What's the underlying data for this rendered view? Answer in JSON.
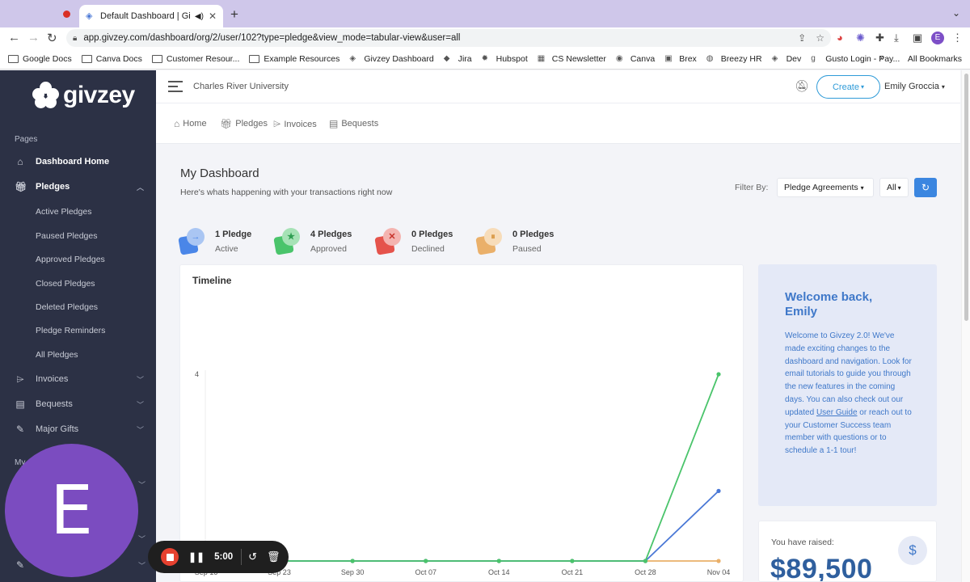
{
  "browser": {
    "tab_title": "Default Dashboard | Givzey",
    "url": "app.givzey.com/dashboard/org/2/user/102?type=pledge&view_mode=tabular-view&user=all",
    "profile_initial": "E",
    "bookmarks": [
      {
        "label": "Google Docs",
        "icon": "folder-icon"
      },
      {
        "label": "Canva Docs",
        "icon": "folder-icon"
      },
      {
        "label": "Customer Resour...",
        "icon": "folder-icon"
      },
      {
        "label": "Example Resources",
        "icon": "folder-icon"
      },
      {
        "label": "Givzey Dashboard",
        "icon": "givzey-icon"
      },
      {
        "label": "Jira",
        "icon": "jira-icon"
      },
      {
        "label": "Hubspot",
        "icon": "hubspot-icon"
      },
      {
        "label": "CS Newsletter",
        "icon": "newsletter-icon"
      },
      {
        "label": "Canva",
        "icon": "canva-icon"
      },
      {
        "label": "Brex",
        "icon": "brex-icon"
      },
      {
        "label": "Breezy HR",
        "icon": "breezy-icon"
      },
      {
        "label": "Dev",
        "icon": "givzey-icon"
      },
      {
        "label": "Gusto Login - Pay...",
        "icon": "gusto-icon"
      }
    ],
    "all_bookmarks": "All Bookmarks"
  },
  "sidebar": {
    "logo": "givzey",
    "section_pages": "Pages",
    "section_my": "My",
    "items": [
      {
        "label": "Dashboard Home",
        "icon": "home-icon"
      },
      {
        "label": "Pledges",
        "icon": "gift-icon"
      },
      {
        "label": "Invoices",
        "icon": "tag-icon"
      },
      {
        "label": "Bequests",
        "icon": "document-icon"
      },
      {
        "label": "Major Gifts",
        "icon": "feather-icon"
      }
    ],
    "pledge_subitems": [
      "Active Pledges",
      "Paused Pledges",
      "Approved Pledges",
      "Closed Pledges",
      "Deleted Pledges",
      "Pledge Reminders",
      "All Pledges"
    ]
  },
  "header": {
    "org_name": "Charles River University",
    "create_label": "Create",
    "user_name": "Emily Groccia"
  },
  "breadcrumbs": [
    {
      "label": "Home",
      "icon": "home-icon"
    },
    {
      "label": "Pledges",
      "icon": "gift-icon"
    },
    {
      "label": "Invoices",
      "icon": "tag-icon"
    },
    {
      "label": "Bequests",
      "icon": "document-icon"
    }
  ],
  "main": {
    "title": "My Dashboard",
    "subtitle": "Here's whats happening with your transactions right now",
    "filter_label": "Filter By:",
    "filter_type": "Pledge Agreements",
    "filter_scope": "All"
  },
  "stats": [
    {
      "count": "1 Pledge",
      "label": "Active",
      "color": "#4a86e8",
      "icon": "arrow-right-icon"
    },
    {
      "count": "4 Pledges",
      "label": "Approved",
      "color": "#4ac46b",
      "icon": "star-icon"
    },
    {
      "count": "0 Pledges",
      "label": "Declined",
      "color": "#e5534b",
      "icon": "x-icon"
    },
    {
      "count": "0 Pledges",
      "label": "Paused",
      "color": "#eab06a",
      "icon": "pause-icon"
    }
  ],
  "timeline": {
    "title": "Timeline",
    "chart_data": {
      "type": "line",
      "categories": [
        "Sep 16",
        "Sep 23",
        "Sep 30",
        "Oct 07",
        "Oct 14",
        "Oct 21",
        "Oct 28",
        "Nov 04"
      ],
      "ytick": "4",
      "series": [
        {
          "color": "#4ac46b",
          "values": [
            0,
            0,
            0,
            0,
            0,
            0,
            0,
            4
          ]
        },
        {
          "color": "#4a78d6",
          "values": [
            0,
            0,
            0,
            0,
            0,
            0,
            0,
            1.5
          ]
        },
        {
          "color": "#eab06a",
          "values": [
            0,
            0,
            0,
            0,
            0,
            0,
            0,
            0
          ]
        }
      ]
    }
  },
  "welcome": {
    "title": "Welcome back, Emily",
    "body_before": "Welcome to Givzey 2.0! We've made exciting changes to the dashboard and navigation. Look for email tutorials to guide you through the new features in the coming days. You can also check out our updated ",
    "link": "User Guide",
    "body_after": " or reach out to your Customer Success team member with questions or to schedule a 1-1 tour!"
  },
  "raised": {
    "label": "You have raised:",
    "value": "$89,500"
  },
  "recorder": {
    "avatar_initial": "E",
    "time": "5:00"
  }
}
